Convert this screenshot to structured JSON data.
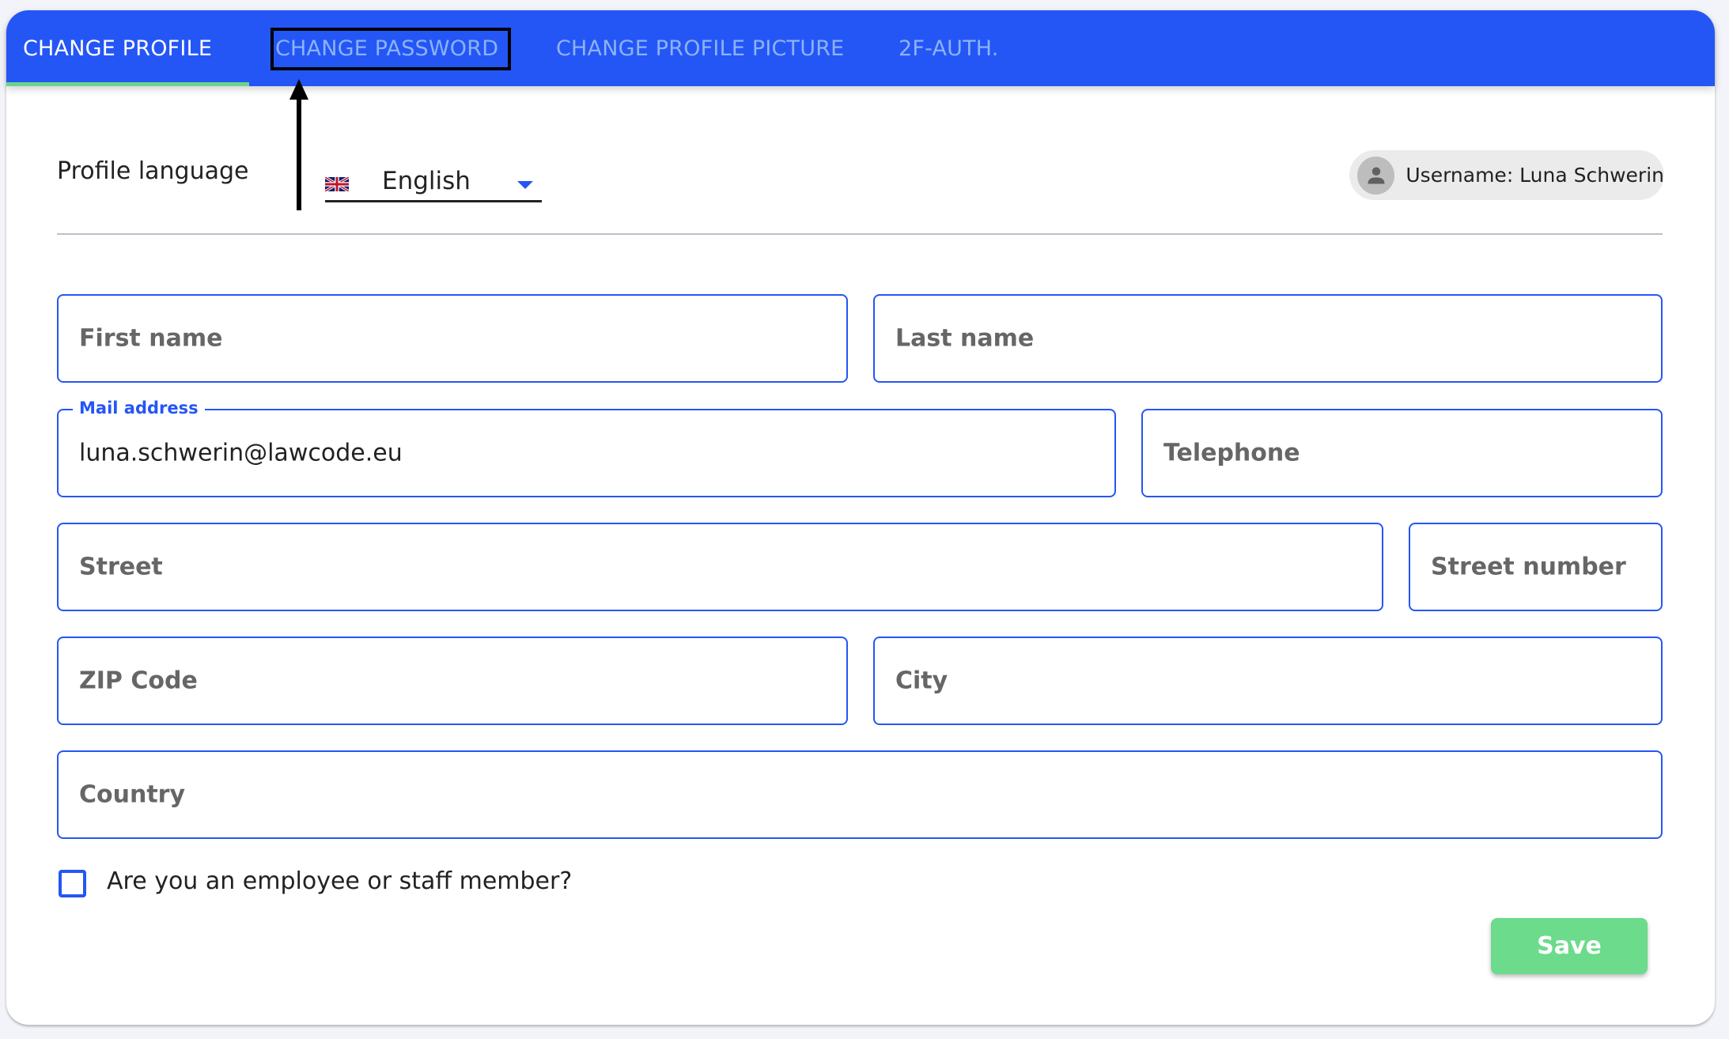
{
  "tabs": [
    {
      "label": "CHANGE PROFILE",
      "active": true
    },
    {
      "label": "CHANGE PASSWORD",
      "active": false
    },
    {
      "label": "CHANGE PROFILE PICTURE",
      "active": false
    },
    {
      "label": "2F-AUTH.",
      "active": false
    }
  ],
  "profile_language": {
    "label": "Profile language",
    "selected": "English",
    "flag_icon": "uk-flag-icon"
  },
  "user_chip": {
    "text": "Username: Luna Schwerin",
    "icon": "person-icon"
  },
  "form": {
    "first_name": {
      "placeholder": "First name",
      "value": ""
    },
    "last_name": {
      "placeholder": "Last name",
      "value": ""
    },
    "mail_address": {
      "label": "Mail address",
      "value": "luna.schwerin@lawcode.eu"
    },
    "telephone": {
      "placeholder": "Telephone",
      "value": ""
    },
    "street": {
      "placeholder": "Street",
      "value": ""
    },
    "street_number": {
      "placeholder": "Street number",
      "value": ""
    },
    "zip_code": {
      "placeholder": "ZIP Code",
      "value": ""
    },
    "city": {
      "placeholder": "City",
      "value": ""
    },
    "country": {
      "placeholder": "Country",
      "value": ""
    },
    "employee_checkbox": {
      "label": "Are you an employee or staff member?",
      "checked": false
    }
  },
  "actions": {
    "save_label": "Save"
  },
  "colors": {
    "primary": "#2456f6",
    "active_tab_indicator": "#6ad48b",
    "inactive_tab_text": "#8cb2f7",
    "save_button": "#6cdb8b"
  }
}
